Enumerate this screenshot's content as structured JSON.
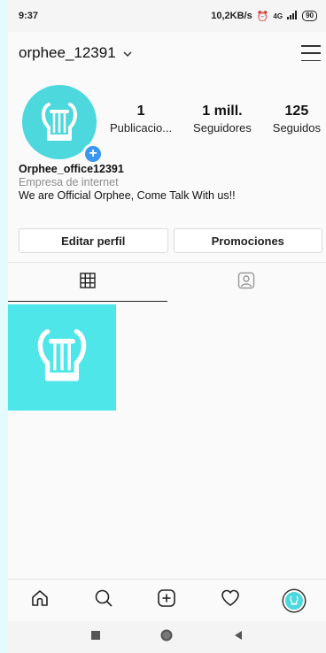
{
  "status_bar": {
    "time": "9:37",
    "network": "10,2KB/s",
    "signal": "4G",
    "battery": "90"
  },
  "header": {
    "username": "orphee_12391"
  },
  "profile": {
    "stats": [
      {
        "value": "1",
        "label": "Publicacio..."
      },
      {
        "value": "1 mill.",
        "label": "Seguidores"
      },
      {
        "value": "125",
        "label": "Seguidos"
      }
    ],
    "name": "Orphee_office12391",
    "category": "Empresa de internet",
    "bio": "We are Official Orphee, Come Talk With us!!"
  },
  "buttons": {
    "edit": "Editar perfil",
    "promotions": "Promociones"
  },
  "tabs": [
    {
      "icon": "grid-icon",
      "active": true
    },
    {
      "icon": "tagged-icon",
      "active": false
    }
  ],
  "bottom_nav": [
    "home-icon",
    "search-icon",
    "add-post-icon",
    "heart-icon",
    "profile-avatar"
  ],
  "colors": {
    "accent": "#4dd8dd",
    "thumb": "#4fe6ea",
    "badge": "#3897f0"
  }
}
